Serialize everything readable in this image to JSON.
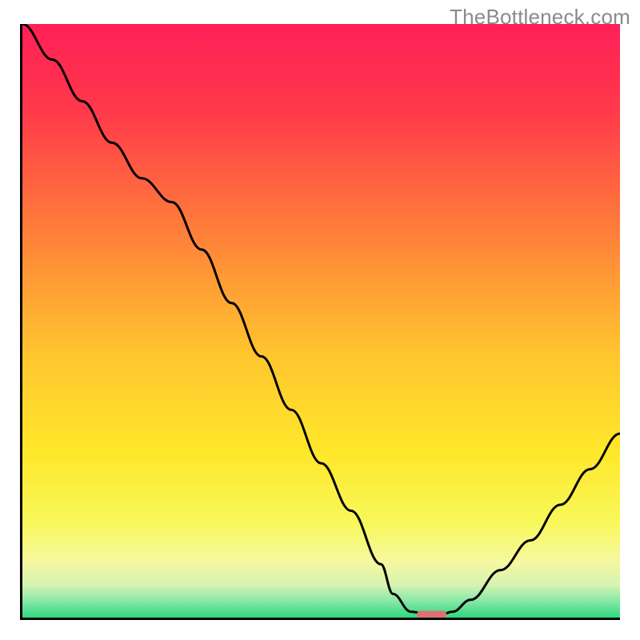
{
  "watermark": "TheBottleneck.com",
  "colors": {
    "axis": "#000000",
    "curve": "#000000",
    "marker": "#e0706d",
    "gradient_stops": [
      {
        "offset": 0.0,
        "color": "#ff1f57"
      },
      {
        "offset": 0.15,
        "color": "#ff3a4a"
      },
      {
        "offset": 0.35,
        "color": "#ff7f3a"
      },
      {
        "offset": 0.55,
        "color": "#ffc32f"
      },
      {
        "offset": 0.72,
        "color": "#ffe72a"
      },
      {
        "offset": 0.84,
        "color": "#f8f85a"
      },
      {
        "offset": 0.905,
        "color": "#f6f8a0"
      },
      {
        "offset": 0.945,
        "color": "#d6f3b0"
      },
      {
        "offset": 0.97,
        "color": "#8de9a9"
      },
      {
        "offset": 1.0,
        "color": "#2fd87e"
      }
    ]
  },
  "chart_data": {
    "type": "line",
    "title": "",
    "xlabel": "",
    "ylabel": "",
    "xlim": [
      0,
      100
    ],
    "ylim": [
      0,
      100
    ],
    "series": [
      {
        "name": "bottleneck-curve",
        "x": [
          0,
          5,
          10,
          15,
          20,
          25,
          30,
          35,
          40,
          45,
          50,
          55,
          60,
          62,
          65,
          68,
          70,
          72,
          75,
          80,
          85,
          90,
          95,
          100
        ],
        "y": [
          100,
          94,
          87,
          80,
          74,
          70,
          62,
          53,
          44,
          35,
          26,
          18,
          9,
          4,
          1,
          0.5,
          0.5,
          1,
          3,
          8,
          13,
          19,
          25,
          31
        ]
      }
    ],
    "marker": {
      "x": 68.5,
      "y": 0.5,
      "width_x": 5,
      "height_y": 1.3
    },
    "annotations": []
  }
}
